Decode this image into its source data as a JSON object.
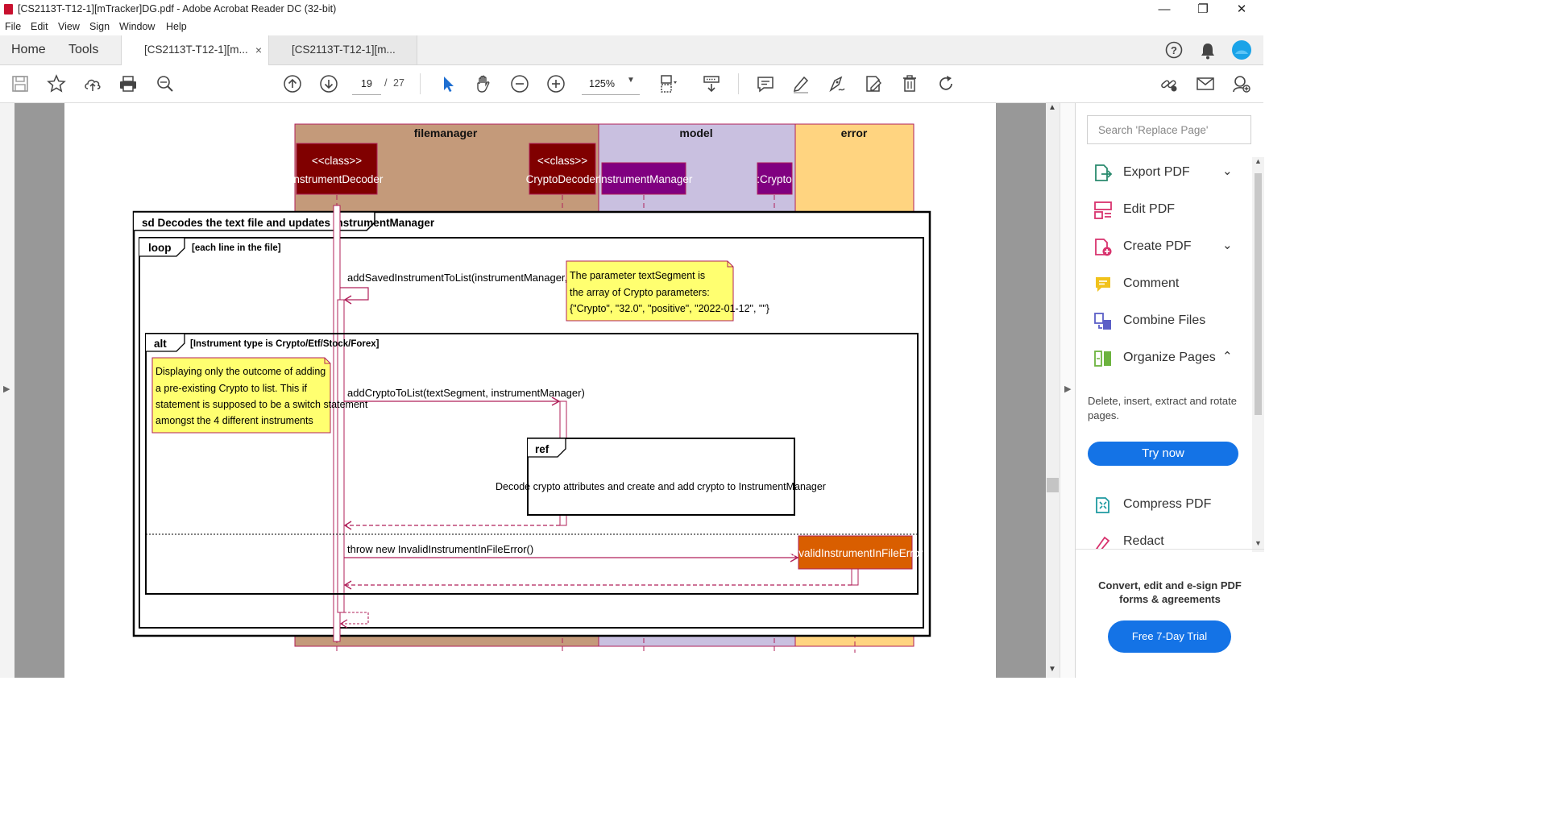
{
  "window": {
    "title": "[CS2113T-T12-1][mTracker]DG.pdf - Adobe Acrobat Reader DC (32-bit)",
    "minimize": "—",
    "restore": "❐",
    "close": "✕"
  },
  "menu": [
    "File",
    "Edit",
    "View",
    "Sign",
    "Window",
    "Help"
  ],
  "tabs": {
    "home": "Home",
    "tools": "Tools",
    "docs": [
      {
        "label": "[CS2113T-T12-1][m...",
        "active": true,
        "close": "×"
      },
      {
        "label": "[CS2113T-T12-1][m...",
        "active": false
      }
    ]
  },
  "toolbar": {
    "page_current": "19",
    "page_sep": "/",
    "page_total": "27",
    "zoom": "125%"
  },
  "right_pane": {
    "search_placeholder": "Search 'Replace Page'",
    "tools": [
      {
        "label": "Export PDF",
        "icon": "export-pdf-icon",
        "chevron": "⌄"
      },
      {
        "label": "Edit PDF",
        "icon": "edit-pdf-icon"
      },
      {
        "label": "Create PDF",
        "icon": "create-pdf-icon",
        "chevron": "⌄"
      },
      {
        "label": "Comment",
        "icon": "comment-icon"
      },
      {
        "label": "Combine Files",
        "icon": "combine-files-icon"
      },
      {
        "label": "Organize Pages",
        "icon": "organize-pages-icon",
        "chevron": "⌃"
      },
      {
        "label": "Compress PDF",
        "icon": "compress-pdf-icon"
      },
      {
        "label": "Redact",
        "icon": "redact-icon"
      }
    ],
    "organize_desc": "Delete, insert, extract and rotate pages.",
    "try_now": "Try now",
    "promo": "Convert, edit and e-sign PDF forms & agreements",
    "trial": "Free 7-Day Trial"
  },
  "diagram": {
    "lanes": [
      "filemanager",
      "model",
      "error"
    ],
    "participants": [
      {
        "stereo": "<<class>>",
        "name": "InstrumentDecoder"
      },
      {
        "stereo": "<<class>>",
        "name": "CryptoDecoder"
      },
      {
        "name": ":InstrumentManager"
      },
      {
        "name": ":Crypto"
      },
      {
        "name": ":InvalidInstrumentInFileError"
      }
    ],
    "frame_title": "sd Decodes the text file and updates InstrumentManager",
    "loop": {
      "tag": "loop",
      "guard": "[each line in the file]"
    },
    "alt": {
      "tag": "alt",
      "guard": "[Instrument type is Crypto/Etf/Stock/Forex]"
    },
    "ref": {
      "tag": "ref",
      "text": "Decode crypto attributes and create and add crypto to InstrumentManager"
    },
    "messages": [
      "addSavedInstrumentToList(instrumentManager, textSegment)",
      "addCryptoToList(textSegment, instrumentManager)",
      "throw new InvalidInstrumentInFileError()"
    ],
    "notes": [
      {
        "lines": [
          "The parameter textSegment is",
          "the array of Crypto parameters:",
          "{\"Crypto\", \"32.0\", \"positive\", \"2022-01-12\", \"\"}"
        ]
      },
      {
        "lines": [
          "Displaying only the outcome of adding",
          "a pre-existing Crypto to list. This if",
          "statement is supposed to be a switch statement",
          "amongst the 4 different instruments"
        ]
      }
    ]
  }
}
